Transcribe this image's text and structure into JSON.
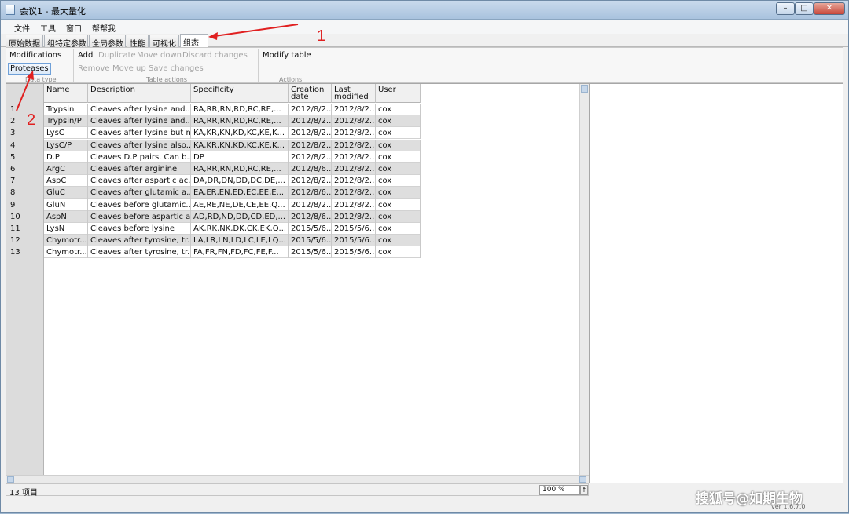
{
  "window": {
    "title": "会议1 - 最大量化",
    "controls": {
      "minimize": "–",
      "maximize": "□",
      "close": "✕"
    }
  },
  "menu": [
    "文件",
    "工具",
    "窗口",
    "帮帮我"
  ],
  "tabs": [
    {
      "label": "原始数据",
      "active": false
    },
    {
      "label": "组特定参数",
      "active": false
    },
    {
      "label": "全局参数",
      "active": false
    },
    {
      "label": "性能",
      "active": false
    },
    {
      "label": "可视化",
      "active": false
    },
    {
      "label": "组态",
      "active": true
    }
  ],
  "ribbon": {
    "data_type": {
      "modifications": "Modifications",
      "proteases": "Proteases",
      "caption": "Data type"
    },
    "table_actions": {
      "add": "Add",
      "duplicate": "Duplicate",
      "move_down": "Move down",
      "discard": "Discard changes",
      "remove": "Remove",
      "move_up": "Move up",
      "save": "Save changes",
      "caption": "Table actions"
    },
    "actions": {
      "modify_table": "Modify table",
      "caption": "Actions"
    }
  },
  "table": {
    "columns": {
      "name": "Name",
      "description": "Description",
      "specificity": "Specificity",
      "creation_1": "Creation",
      "creation_2": "date",
      "modified_1": "Last",
      "modified_2": "modified",
      "user": "User"
    },
    "rows": [
      {
        "n": "1",
        "name": "Trypsin",
        "desc": "Cleaves after lysine and...",
        "spec": "RA,RR,RN,RD,RC,RE,...",
        "created": "2012/8/2...",
        "modified": "2012/8/2...",
        "user": "cox"
      },
      {
        "n": "2",
        "name": "Trypsin/P",
        "desc": "Cleaves after lysine and...",
        "spec": "RA,RR,RN,RD,RC,RE,...",
        "created": "2012/8/2...",
        "modified": "2012/8/2...",
        "user": "cox"
      },
      {
        "n": "3",
        "name": "LysC",
        "desc": "Cleaves after lysine but n...",
        "spec": "KA,KR,KN,KD,KC,KE,K...",
        "created": "2012/8/2...",
        "modified": "2012/8/2...",
        "user": "cox"
      },
      {
        "n": "4",
        "name": "LysC/P",
        "desc": "Cleaves after lysine also...",
        "spec": "KA,KR,KN,KD,KC,KE,K...",
        "created": "2012/8/2...",
        "modified": "2012/8/2...",
        "user": "cox"
      },
      {
        "n": "5",
        "name": "D.P",
        "desc": "Cleaves D.P pairs. Can b...",
        "spec": "DP",
        "created": "2012/8/2...",
        "modified": "2012/8/2...",
        "user": "cox"
      },
      {
        "n": "6",
        "name": "ArgC",
        "desc": "Cleaves after arginine",
        "spec": "RA,RR,RN,RD,RC,RE,...",
        "created": "2012/8/6...",
        "modified": "2012/8/2...",
        "user": "cox"
      },
      {
        "n": "7",
        "name": "AspC",
        "desc": "Cleaves after aspartic ac...",
        "spec": "DA,DR,DN,DD,DC,DE,...",
        "created": "2012/8/2...",
        "modified": "2012/8/2...",
        "user": "cox"
      },
      {
        "n": "8",
        "name": "GluC",
        "desc": "Cleaves after glutamic a...",
        "spec": "EA,ER,EN,ED,EC,EE,E...",
        "created": "2012/8/6...",
        "modified": "2012/8/2...",
        "user": "cox"
      },
      {
        "n": "9",
        "name": "GluN",
        "desc": "Cleaves before glutamic...",
        "spec": "AE,RE,NE,DE,CE,EE,Q...",
        "created": "2012/8/2...",
        "modified": "2012/8/2...",
        "user": "cox"
      },
      {
        "n": "10",
        "name": "AspN",
        "desc": "Cleaves before aspartic a...",
        "spec": "AD,RD,ND,DD,CD,ED,...",
        "created": "2012/8/6...",
        "modified": "2012/8/2...",
        "user": "cox"
      },
      {
        "n": "11",
        "name": "LysN",
        "desc": "Cleaves before lysine",
        "spec": "AK,RK,NK,DK,CK,EK,Q...",
        "created": "2015/5/6...",
        "modified": "2015/5/6...",
        "user": "cox"
      },
      {
        "n": "12",
        "name": "Chymotr...",
        "desc": "Cleaves after tyrosine, tr...",
        "spec": "LA,LR,LN,LD,LC,LE,LQ...",
        "created": "2015/5/6...",
        "modified": "2015/5/6...",
        "user": "cox"
      },
      {
        "n": "13",
        "name": "Chymotr...",
        "desc": "Cleaves after tyrosine, tr...",
        "spec": "FA,FR,FN,FD,FC,FE,F...",
        "created": "2015/5/6...",
        "modified": "2015/5/6...",
        "user": "cox"
      }
    ]
  },
  "status": {
    "count": "13 项目",
    "zoom": "100 %",
    "zoom_button": "↑",
    "version": "ver 1.6.7.0"
  },
  "annotations": {
    "one": "1",
    "two": "2",
    "color": "#e02020"
  },
  "watermark": "搜狐号@如期生物"
}
